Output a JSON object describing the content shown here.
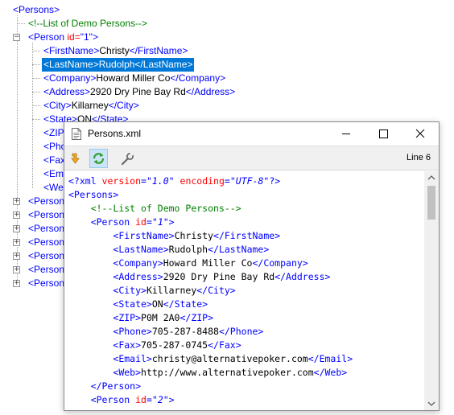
{
  "tree": {
    "root": "<Persons>",
    "comment": "<!--List of Demo Persons-->",
    "person1": {
      "open": "<Person ",
      "attr": "id=",
      "val": "\"1\"",
      "close": ">"
    },
    "children": [
      {
        "open": "<FirstName>",
        "text": "Christy",
        "close": "</FirstName>"
      },
      {
        "open": "<LastName>",
        "text": "Rudolph",
        "close": "</LastName>",
        "selected": true
      },
      {
        "open": "<Company>",
        "text": "Howard Miller Co",
        "close": "</Company>"
      },
      {
        "open": "<Address>",
        "text": "2920 Dry Pine Bay Rd",
        "close": "</Address>"
      },
      {
        "open": "<City>",
        "text": "Killarney",
        "close": "</City>"
      },
      {
        "open": "<State>",
        "text": "ON",
        "close": "</State>"
      },
      {
        "open": "<ZIP",
        "text": "",
        "close": ""
      },
      {
        "open": "<Pho",
        "text": "",
        "close": ""
      },
      {
        "open": "<Fax",
        "text": "",
        "close": ""
      },
      {
        "open": "<Ema",
        "text": "",
        "close": ""
      },
      {
        "open": "<We",
        "text": "",
        "close": ""
      }
    ],
    "collapsed_persons": [
      "<Person",
      "<Person",
      "<Person",
      "<Person",
      "<Person",
      "<Person",
      "<Person"
    ]
  },
  "window": {
    "title": "Persons.xml",
    "line_indicator": "Line 6",
    "toolbar_icons": [
      "sync-down-icon",
      "refresh-icon",
      "wrench-icon"
    ]
  },
  "code_lines": [
    [
      [
        "c-pi",
        "<?xml "
      ],
      [
        "c-attr",
        "version"
      ],
      [
        "c-pi",
        "="
      ],
      [
        "c-str",
        "\"1.0\""
      ],
      [
        "c-pi",
        " "
      ],
      [
        "c-attr",
        "encoding"
      ],
      [
        "c-pi",
        "="
      ],
      [
        "c-str",
        "\"UTF-8\""
      ],
      [
        "c-pi",
        "?>"
      ]
    ],
    [
      [
        "c-tag",
        "<Persons>"
      ]
    ],
    [
      [
        "c-text",
        "    "
      ],
      [
        "c-comment",
        "<!--List of Demo Persons-->"
      ]
    ],
    [
      [
        "c-text",
        "    "
      ],
      [
        "c-tag",
        "<Person "
      ],
      [
        "c-attr",
        "id"
      ],
      [
        "c-tag",
        "="
      ],
      [
        "c-str",
        "\"1\""
      ],
      [
        "c-tag",
        ">"
      ]
    ],
    [
      [
        "c-text",
        "        "
      ],
      [
        "c-tag",
        "<FirstName>"
      ],
      [
        "c-text",
        "Christy"
      ],
      [
        "c-tag",
        "</FirstName>"
      ]
    ],
    [
      [
        "c-text",
        "        "
      ],
      [
        "c-tag",
        "<LastName>"
      ],
      [
        "c-text",
        "Rudolph"
      ],
      [
        "c-tag",
        "</LastName>"
      ]
    ],
    [
      [
        "c-text",
        "        "
      ],
      [
        "c-tag",
        "<Company>"
      ],
      [
        "c-text",
        "Howard Miller Co"
      ],
      [
        "c-tag",
        "</Company>"
      ]
    ],
    [
      [
        "c-text",
        "        "
      ],
      [
        "c-tag",
        "<Address>"
      ],
      [
        "c-text",
        "2920 Dry Pine Bay Rd"
      ],
      [
        "c-tag",
        "</Address>"
      ]
    ],
    [
      [
        "c-text",
        "        "
      ],
      [
        "c-tag",
        "<City>"
      ],
      [
        "c-text",
        "Killarney"
      ],
      [
        "c-tag",
        "</City>"
      ]
    ],
    [
      [
        "c-text",
        "        "
      ],
      [
        "c-tag",
        "<State>"
      ],
      [
        "c-text",
        "ON"
      ],
      [
        "c-tag",
        "</State>"
      ]
    ],
    [
      [
        "c-text",
        "        "
      ],
      [
        "c-tag",
        "<ZIP>"
      ],
      [
        "c-text",
        "P0M 2A0"
      ],
      [
        "c-tag",
        "</ZIP>"
      ]
    ],
    [
      [
        "c-text",
        "        "
      ],
      [
        "c-tag",
        "<Phone>"
      ],
      [
        "c-text",
        "705-287-8488"
      ],
      [
        "c-tag",
        "</Phone>"
      ]
    ],
    [
      [
        "c-text",
        "        "
      ],
      [
        "c-tag",
        "<Fax>"
      ],
      [
        "c-text",
        "705-287-0745"
      ],
      [
        "c-tag",
        "</Fax>"
      ]
    ],
    [
      [
        "c-text",
        "        "
      ],
      [
        "c-tag",
        "<Email>"
      ],
      [
        "c-text",
        "christy@alternativepoker.com"
      ],
      [
        "c-tag",
        "</Email>"
      ]
    ],
    [
      [
        "c-text",
        "        "
      ],
      [
        "c-tag",
        "<Web>"
      ],
      [
        "c-text",
        "http://www.alternativepoker.com"
      ],
      [
        "c-tag",
        "</Web>"
      ]
    ],
    [
      [
        "c-text",
        "    "
      ],
      [
        "c-tag",
        "</Person>"
      ]
    ],
    [
      [
        "c-text",
        "    "
      ],
      [
        "c-tag",
        "<Person "
      ],
      [
        "c-attr",
        "id"
      ],
      [
        "c-tag",
        "="
      ],
      [
        "c-str",
        "\"2\""
      ],
      [
        "c-tag",
        ">"
      ]
    ]
  ],
  "colors": {
    "tag": "#0000ff",
    "attr": "#ff0000",
    "comment": "#008000",
    "selection": "#0078d7"
  }
}
